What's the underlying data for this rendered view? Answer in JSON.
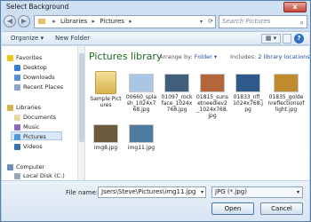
{
  "window": {
    "title": "Select Background",
    "close_glyph": "x"
  },
  "nav": {
    "back_glyph": "◀",
    "forward_glyph": "▶",
    "address": [
      "Libraries",
      "Pictures"
    ],
    "address_sep": "▸",
    "search_placeholder": "Search Pictures"
  },
  "toolbar": {
    "organize_label": "Organize ▾",
    "new_folder_label": "New Folder",
    "view_glyph": "▦ ▾",
    "help_glyph": "?"
  },
  "sidebar": {
    "favorites_label": "Favorites",
    "favorites": [
      "Desktop",
      "Downloads",
      "Recent Places"
    ],
    "libraries_label": "Libraries",
    "libraries": [
      "Documents",
      "Music",
      "Pictures",
      "Videos"
    ],
    "computer_label": "Computer",
    "computer": [
      "Local Disk (C:)"
    ]
  },
  "library": {
    "title": "Pictures library",
    "arrange_label": "Arrange by:",
    "arrange_value": "Folder ▾",
    "includes_label": "Includes:",
    "includes_value": "2 library locations",
    "items": [
      {
        "label": "Sample Pictures",
        "kind": "folder"
      },
      {
        "label": "00660_splash_1024x768.jpg",
        "kind": "image",
        "color": "#a9c7e5"
      },
      {
        "label": "01097_rockface_1024x768.jpg",
        "kind": "image",
        "color": "#3f5f7d"
      },
      {
        "label": "01815_sunsetneedlev2_1024x768.jpg",
        "kind": "image",
        "color": "#b5653a"
      },
      {
        "label": "01833_nfl_1024x768.jpg",
        "kind": "image",
        "color": "#2d5a8a"
      },
      {
        "label": "01835_goldenreflectionsoflight.jpg",
        "kind": "image",
        "color": "#c08a2e"
      },
      {
        "label": "img8.jpg",
        "kind": "image",
        "color": "#6b5a3e"
      },
      {
        "label": "img11.jpg",
        "kind": "image",
        "color": "#4d7a9e"
      }
    ]
  },
  "footer": {
    "filename_label": "File name:",
    "filename_value": "Jsers\\Steve\\Pictures\\img11.jpg",
    "filter_value": "JPG (*.jpg)",
    "open_label": "Open",
    "cancel_label": "Cancel"
  },
  "colors": {
    "accent": "#1d6b1d",
    "link": "#1f4e9c",
    "selection": "#d9e8f8"
  }
}
